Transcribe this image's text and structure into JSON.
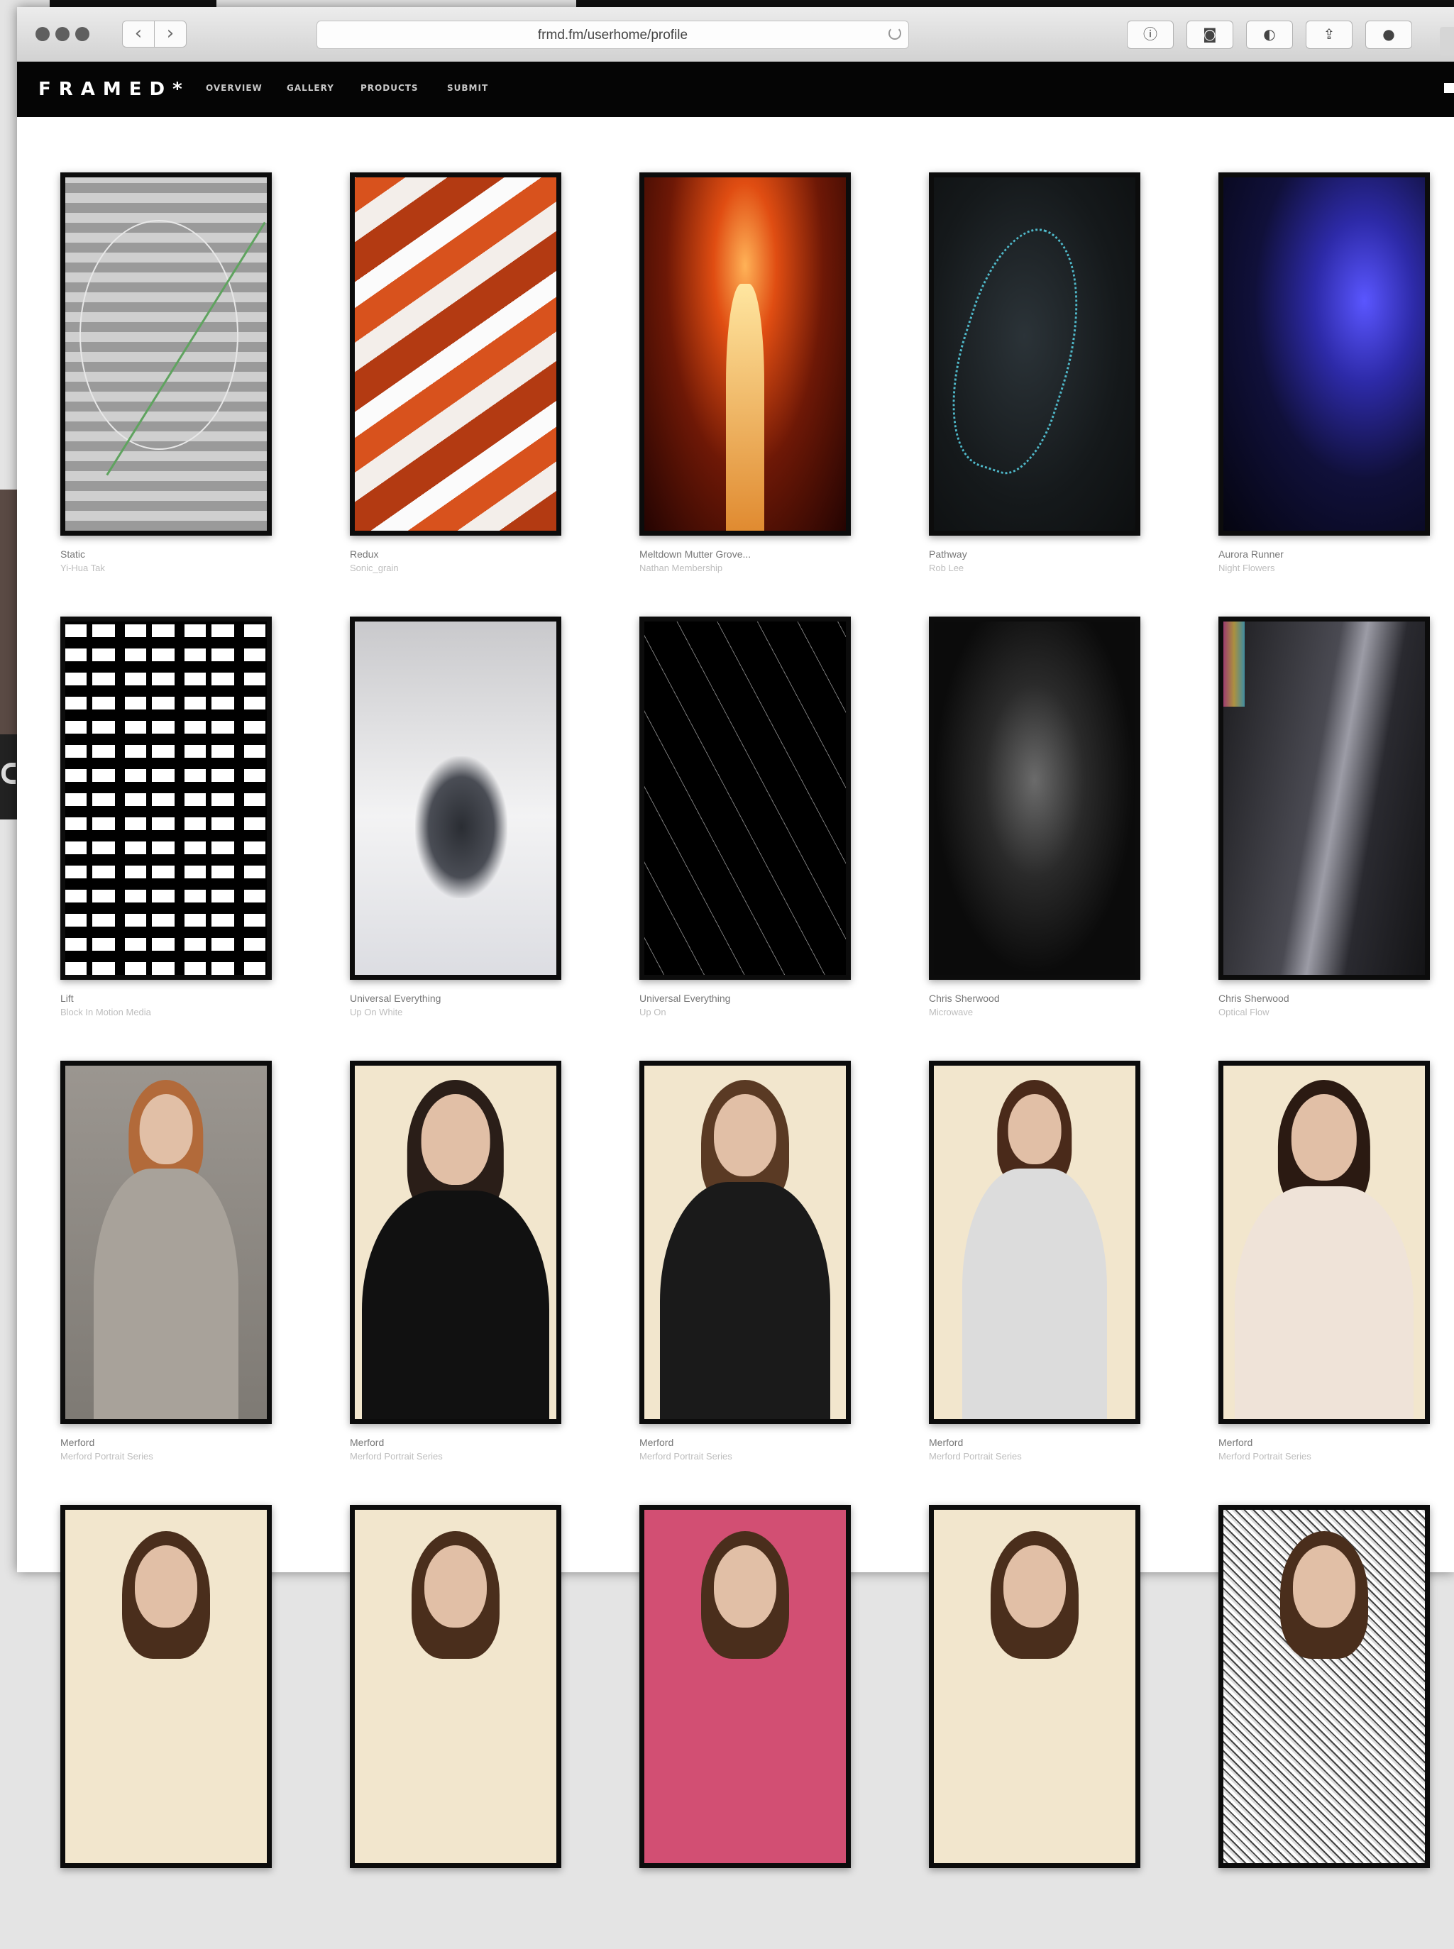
{
  "browser": {
    "url": "frmd.fm/userhome/profile",
    "toolbar_icons": [
      "info-icon",
      "pocket-icon",
      "theme-icon",
      "share-icon",
      "onepassword-icon"
    ]
  },
  "site": {
    "logo": "FRAMED*",
    "nav": [
      "OVERVIEW",
      "GALLERY",
      "PRODUCTS",
      "SUBMIT"
    ]
  },
  "gallery": {
    "artworks": [
      {
        "title": "Static",
        "artist": "Yi-Hua Tak",
        "style": "a1"
      },
      {
        "title": "Redux",
        "artist": "Sonic_grain",
        "style": "a2"
      },
      {
        "title": "Meltdown Mutter Grove...",
        "artist": "Nathan Membership",
        "style": "a3"
      },
      {
        "title": "Pathway",
        "artist": "Rob Lee",
        "style": "a4"
      },
      {
        "title": "Aurora Runner",
        "artist": "Night Flowers",
        "style": "a5"
      },
      {
        "title": "Lift",
        "artist": "Block In Motion Media",
        "style": "a6"
      },
      {
        "title": "Universal Everything",
        "artist": "Up On White",
        "style": "a7"
      },
      {
        "title": "Universal Everything",
        "artist": "Up On",
        "style": "a8"
      },
      {
        "title": "Chris Sherwood",
        "artist": "Microwave",
        "style": "a9"
      },
      {
        "title": "Chris Sherwood",
        "artist": "Optical Flow",
        "style": "a10"
      },
      {
        "title": "Merford",
        "artist": "Merford Portrait Series",
        "style": "p-grey"
      },
      {
        "title": "Merford",
        "artist": "Merford Portrait Series",
        "style": "p-cream"
      },
      {
        "title": "Merford",
        "artist": "Merford Portrait Series",
        "style": "p-cream"
      },
      {
        "title": "Merford",
        "artist": "Merford Portrait Series",
        "style": "p-cream"
      },
      {
        "title": "Merford",
        "artist": "Merford Portrait Series",
        "style": "p-cream"
      },
      {
        "title": "",
        "artist": "",
        "style": "p-cream"
      },
      {
        "title": "",
        "artist": "",
        "style": "p-cream"
      },
      {
        "title": "",
        "artist": "",
        "style": "p-pink"
      },
      {
        "title": "",
        "artist": "",
        "style": "p-cream"
      },
      {
        "title": "",
        "artist": "",
        "style": "p-sketch"
      }
    ]
  }
}
